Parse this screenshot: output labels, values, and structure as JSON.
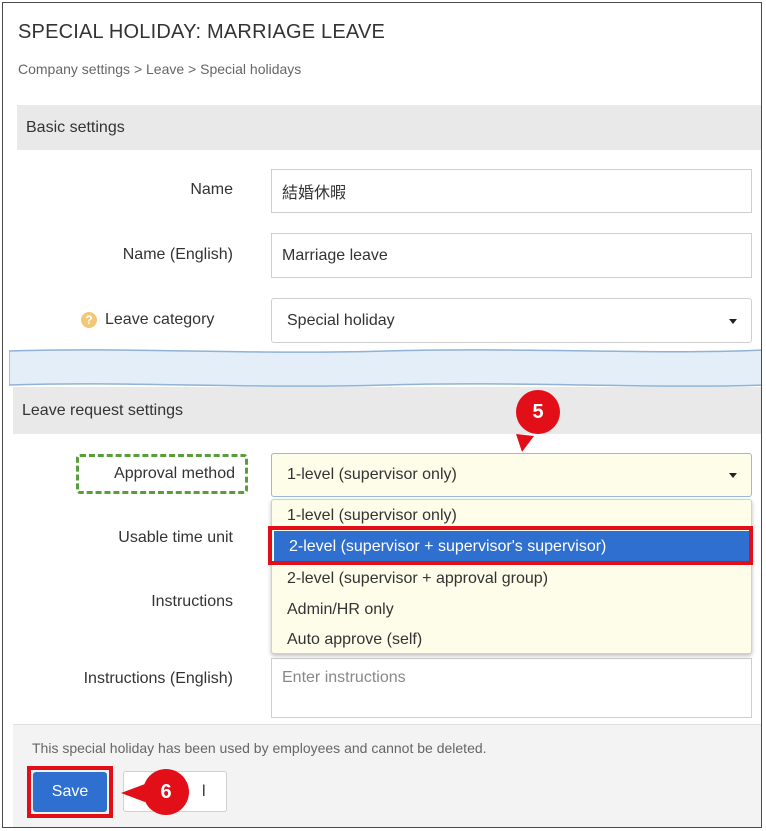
{
  "page": {
    "title": "SPECIAL HOLIDAY: MARRIAGE LEAVE",
    "breadcrumb": "Company settings > Leave > Special holidays"
  },
  "basic": {
    "header": "Basic settings",
    "name_label": "Name",
    "name_value": "結婚休暇",
    "name_en_label": "Name (English)",
    "name_en_value": "Marriage leave",
    "category_label": "Leave category",
    "category_value": "Special holiday"
  },
  "request": {
    "header": "Leave request settings",
    "approval_label": "Approval method",
    "approval_value": "1-level (supervisor only)",
    "approval_options": [
      "1-level (supervisor only)",
      "2-level (supervisor + supervisor's supervisor)",
      "2-level (supervisor + approval group)",
      "Admin/HR only",
      "Auto approve (self)"
    ],
    "time_unit_label": "Usable time unit",
    "instructions_label": "Instructions",
    "instructions_en_label": "Instructions (English)",
    "instructions_en_placeholder": "Enter instructions"
  },
  "footer": {
    "note": "This special holiday has been used by employees and cannot be deleted.",
    "save_label": "Save",
    "cancel_label": "l"
  },
  "annotations": {
    "step5": "5",
    "step6": "6"
  },
  "colors": {
    "accent": "#2e6fd0",
    "highlight": "#e20e18",
    "dashed_outline": "#5a9e3a",
    "dropdown_bg": "#fdfdea"
  }
}
